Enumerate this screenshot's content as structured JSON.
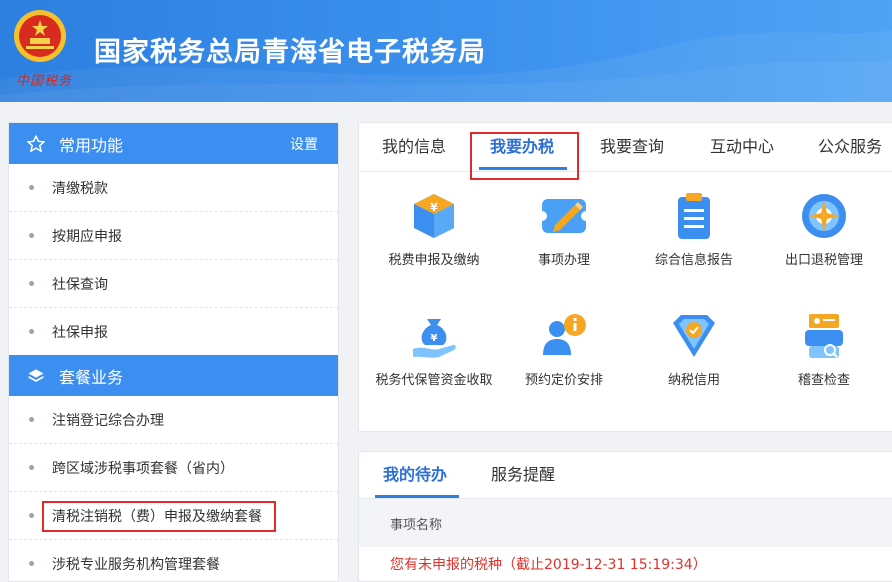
{
  "header": {
    "title": "国家税务总局青海省电子税务局",
    "brand_text": "中国税务"
  },
  "colors": {
    "header_blue": "#3e93ef",
    "section_blue": "#3c8ff1",
    "active_tab": "#2d6fd6",
    "alert_red": "#e0312b",
    "highlight_box": "#e22a2a"
  },
  "sidebar": {
    "common": {
      "icon": "star-icon",
      "title": "常用功能",
      "setting_label": "设置",
      "items": [
        "清缴税款",
        "按期应申报",
        "社保查询",
        "社保申报"
      ]
    },
    "package": {
      "icon": "layers-icon",
      "title": "套餐业务",
      "items": [
        "注销登记综合办理",
        "跨区域涉税事项套餐（省内）",
        "清税注销税（费）申报及缴纳套餐",
        "涉税专业服务机构管理套餐"
      ]
    }
  },
  "main": {
    "tabs": [
      "我的信息",
      "我要办税",
      "我要查询",
      "互动中心",
      "公众服务"
    ],
    "active_tab": "我要办税",
    "functions": [
      {
        "icon": "tax-cube-icon",
        "label": "税费申报及缴纳"
      },
      {
        "icon": "pencil-ticket-icon",
        "label": "事项办理"
      },
      {
        "icon": "clipboard-report-icon",
        "label": "综合信息报告"
      },
      {
        "icon": "globe-refund-icon",
        "label": "出口退税管理"
      },
      {
        "icon": "money-bag-hand-icon",
        "label": "税务代保管资金收取"
      },
      {
        "icon": "user-info-icon",
        "label": "预约定价安排"
      },
      {
        "icon": "shield-check-icon",
        "label": "纳税信用"
      },
      {
        "icon": "inspector-search-icon",
        "label": "稽查检查"
      }
    ]
  },
  "todo": {
    "tabs": [
      "我的待办",
      "服务提醒"
    ],
    "active_tab": "我的待办",
    "column_header": "事项名称",
    "notice": "您有未申报的税种（截止2019-12-31 15:19:34）"
  }
}
